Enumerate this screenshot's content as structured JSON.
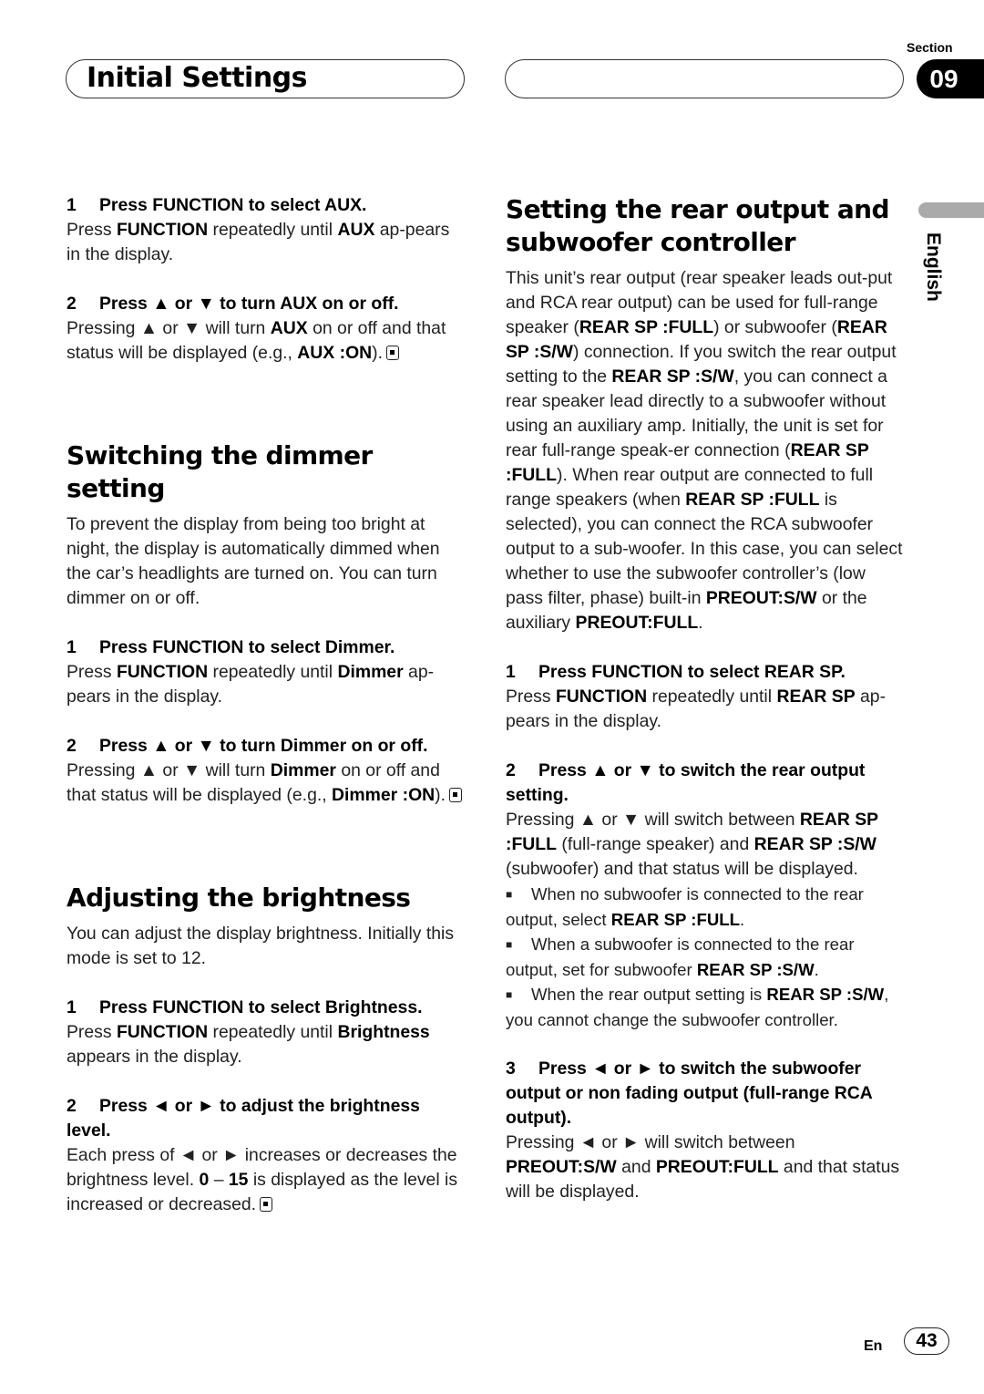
{
  "header": {
    "title": "Initial Settings",
    "section_label": "Section",
    "section_number": "09",
    "language_tab": "English"
  },
  "left_column": [
    {
      "type": "step",
      "num": "1",
      "title": "Press FUNCTION to select AUX."
    },
    {
      "type": "para",
      "runs": [
        [
          "Press ",
          0
        ],
        [
          "FUNCTION",
          1
        ],
        [
          " repeatedly until ",
          0
        ],
        [
          "AUX",
          1
        ],
        [
          " ap-pears in the display.",
          0
        ]
      ]
    },
    {
      "type": "gap"
    },
    {
      "type": "step",
      "num": "2",
      "title": "Press ▲ or ▼ to turn AUX on or off."
    },
    {
      "type": "para",
      "runs": [
        [
          "Pressing ▲ or ▼ will turn ",
          0
        ],
        [
          "AUX",
          1
        ],
        [
          " on or off and that status will be displayed (e.g., ",
          0
        ],
        [
          "AUX :ON",
          1
        ],
        [
          ").",
          0
        ]
      ],
      "endmark": true
    },
    {
      "type": "gapl"
    },
    {
      "type": "heading",
      "text": "Switching the dimmer setting"
    },
    {
      "type": "para",
      "runs": [
        [
          "To prevent the display from being too bright at night, the display is automatically dimmed when the car’s headlights are turned on. You can turn dimmer on or off.",
          0
        ]
      ]
    },
    {
      "type": "gap"
    },
    {
      "type": "step",
      "num": "1",
      "title": "Press FUNCTION to select Dimmer."
    },
    {
      "type": "para",
      "runs": [
        [
          "Press ",
          0
        ],
        [
          "FUNCTION",
          1
        ],
        [
          " repeatedly until ",
          0
        ],
        [
          "Dimmer",
          1
        ],
        [
          " ap-pears in the display.",
          0
        ]
      ]
    },
    {
      "type": "gap"
    },
    {
      "type": "step",
      "num": "2",
      "title": "Press ▲ or ▼ to turn Dimmer on or off."
    },
    {
      "type": "para",
      "runs": [
        [
          "Pressing ▲ or ▼ will turn ",
          0
        ],
        [
          "Dimmer",
          1
        ],
        [
          " on or off and that status will be displayed (e.g., ",
          0
        ],
        [
          "Dimmer :ON",
          1
        ],
        [
          ").",
          0
        ]
      ],
      "endmark": true
    },
    {
      "type": "gapl"
    },
    {
      "type": "heading",
      "text": "Adjusting the brightness"
    },
    {
      "type": "para",
      "runs": [
        [
          "You can adjust the display brightness. Initially this mode is set to 12.",
          0
        ]
      ]
    },
    {
      "type": "gap"
    },
    {
      "type": "step",
      "num": "1",
      "title": "Press FUNCTION to select Brightness."
    },
    {
      "type": "para",
      "runs": [
        [
          "Press ",
          0
        ],
        [
          "FUNCTION",
          1
        ],
        [
          " repeatedly until ",
          0
        ],
        [
          "Brightness",
          1
        ],
        [
          " appears in the display.",
          0
        ]
      ]
    },
    {
      "type": "gap"
    },
    {
      "type": "step",
      "num": "2",
      "title": "Press ◄ or ► to adjust the brightness level."
    },
    {
      "type": "para",
      "runs": [
        [
          "Each press of ◄ or ► increases or decreases the brightness level. ",
          0
        ],
        [
          "0",
          1
        ],
        [
          " – ",
          0
        ],
        [
          "15",
          1
        ],
        [
          " is displayed as the level is increased or decreased.",
          0
        ]
      ],
      "endmark": true
    }
  ],
  "right_column": [
    {
      "type": "heading",
      "text": "Setting the rear output and subwoofer controller"
    },
    {
      "type": "para",
      "runs": [
        [
          "This unit’s rear output (rear speaker leads out-put and RCA rear output) can be used for full-range speaker (",
          0
        ],
        [
          "REAR SP :FULL",
          1
        ],
        [
          ") or subwoofer (",
          0
        ],
        [
          "REAR SP :S/W",
          1
        ],
        [
          ") connection. If you switch the rear output setting to the ",
          0
        ],
        [
          "REAR SP :S/W",
          1
        ],
        [
          ", you can connect a rear speaker lead directly to a subwoofer without using an auxiliary amp. Initially, the unit is set for rear full-range speak-er connection (",
          0
        ],
        [
          "REAR SP :FULL",
          1
        ],
        [
          "). When rear output are connected to full range speakers (when ",
          0
        ],
        [
          "REAR SP :FULL",
          1
        ],
        [
          " is selected), you can connect the RCA subwoofer output to a sub-woofer. In this case, you can select whether to use the subwoofer controller’s (low pass filter, phase) built-in ",
          0
        ],
        [
          "PREOUT:S/W",
          1
        ],
        [
          " or the auxiliary ",
          0
        ],
        [
          "PREOUT:FULL",
          1
        ],
        [
          ".",
          0
        ]
      ]
    },
    {
      "type": "gap"
    },
    {
      "type": "step",
      "num": "1",
      "title": "Press FUNCTION to select REAR SP."
    },
    {
      "type": "para",
      "runs": [
        [
          "Press ",
          0
        ],
        [
          "FUNCTION",
          1
        ],
        [
          " repeatedly until ",
          0
        ],
        [
          "REAR SP",
          1
        ],
        [
          " ap-pears in the display.",
          0
        ]
      ]
    },
    {
      "type": "gap"
    },
    {
      "type": "step",
      "num": "2",
      "title": "Press ▲ or ▼ to switch the rear output setting."
    },
    {
      "type": "para",
      "runs": [
        [
          "Pressing ▲ or ▼ will switch between ",
          0
        ],
        [
          "REAR SP :FULL",
          1
        ],
        [
          " (full-range speaker) and ",
          0
        ],
        [
          "REAR SP :S/W",
          1
        ],
        [
          " (subwoofer) and that status will be displayed.",
          0
        ]
      ]
    },
    {
      "type": "note",
      "runs": [
        [
          "When no subwoofer is connected to the rear output, select ",
          0
        ],
        [
          "REAR SP :FULL",
          1
        ],
        [
          ".",
          0
        ]
      ]
    },
    {
      "type": "note",
      "runs": [
        [
          "When a subwoofer is connected to the rear output, set for subwoofer ",
          0
        ],
        [
          "REAR SP :S/W",
          1
        ],
        [
          ".",
          0
        ]
      ]
    },
    {
      "type": "note",
      "runs": [
        [
          "When the rear output setting is ",
          0
        ],
        [
          "REAR SP :S/W",
          1
        ],
        [
          ", you cannot change the subwoofer controller.",
          0
        ]
      ]
    },
    {
      "type": "gap"
    },
    {
      "type": "step",
      "num": "3",
      "title": "Press ◄ or ► to switch the subwoofer output or non fading output (full-range RCA output)."
    },
    {
      "type": "para",
      "runs": [
        [
          "Pressing ◄ or ► will switch between ",
          0
        ],
        [
          "PREOUT:S/W",
          1
        ],
        [
          " and ",
          0
        ],
        [
          "PREOUT:FULL",
          1
        ],
        [
          " and that status will be displayed.",
          0
        ]
      ]
    }
  ],
  "footer": {
    "lang_code": "En",
    "page_number": "43"
  }
}
